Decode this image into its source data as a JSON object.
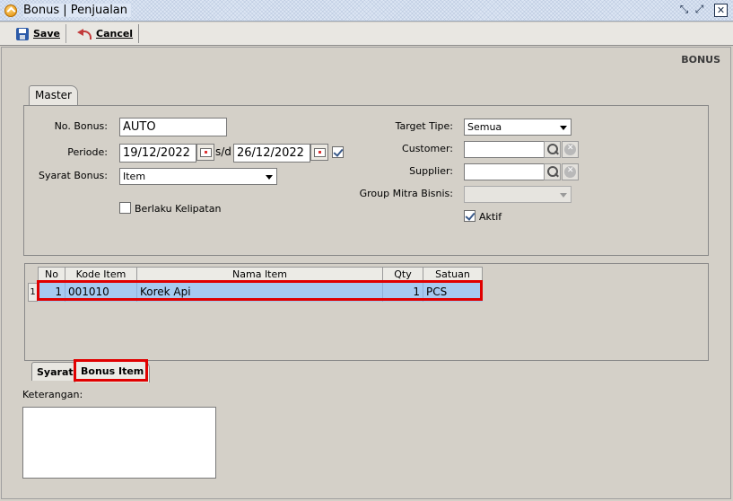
{
  "window": {
    "title": "Bonus | Penjualan"
  },
  "toolbar": {
    "save_label": "Save",
    "cancel_label": "Cancel"
  },
  "page_label": "BONUS",
  "tabs": {
    "master": "Master",
    "syarat": "Syarat",
    "bonus_item": "Bonus Item"
  },
  "form": {
    "no_bonus_label": "No. Bonus:",
    "no_bonus_value": "AUTO",
    "periode_label": "Periode:",
    "periode_from": "19/12/2022",
    "periode_sep": "s/d",
    "periode_to": "26/12/2022",
    "periode_checked": true,
    "syarat_bonus_label": "Syarat Bonus:",
    "syarat_bonus_value": "Item",
    "berlaku_kelipatan_label": "Berlaku Kelipatan",
    "berlaku_kelipatan_checked": false,
    "target_tipe_label": "Target Tipe:",
    "target_tipe_value": "Semua",
    "customer_label": "Customer:",
    "customer_value": "",
    "supplier_label": "Supplier:",
    "supplier_value": "",
    "group_mitra_label": "Group Mitra Bisnis:",
    "group_mitra_value": "",
    "aktif_label": "Aktif",
    "aktif_checked": true
  },
  "grid": {
    "headers": {
      "no": "No",
      "kode": "Kode Item",
      "nama": "Nama Item",
      "qty": "Qty",
      "satuan": "Satuan"
    },
    "rows": [
      {
        "index": "1",
        "no": "1",
        "kode": "001010",
        "nama": "Korek Api",
        "qty": "1",
        "satuan": "PCS"
      }
    ]
  },
  "keterangan_label": "Keterangan:",
  "keterangan_value": ""
}
